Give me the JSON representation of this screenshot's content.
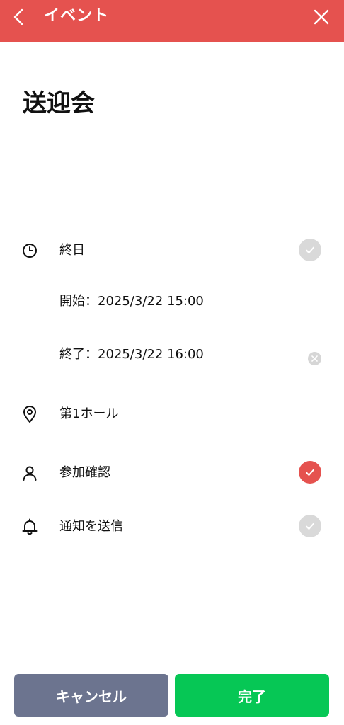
{
  "header": {
    "title": "イベント",
    "bg_color": "#e5524f"
  },
  "event": {
    "title": "送迎会"
  },
  "allday": {
    "label": "終日",
    "enabled": false
  },
  "start": {
    "text": "開始：2025/3/22 15:00"
  },
  "end": {
    "text": "終了：2025/3/22 16:00"
  },
  "location": {
    "text": "第1ホール"
  },
  "attendance": {
    "label": "参加確認",
    "enabled": true
  },
  "notify": {
    "label": "通知を送信",
    "enabled": false
  },
  "buttons": {
    "cancel_label": "キャンセル",
    "done_label": "完了",
    "cancel_color": "#6c748f",
    "done_color": "#06c755"
  }
}
